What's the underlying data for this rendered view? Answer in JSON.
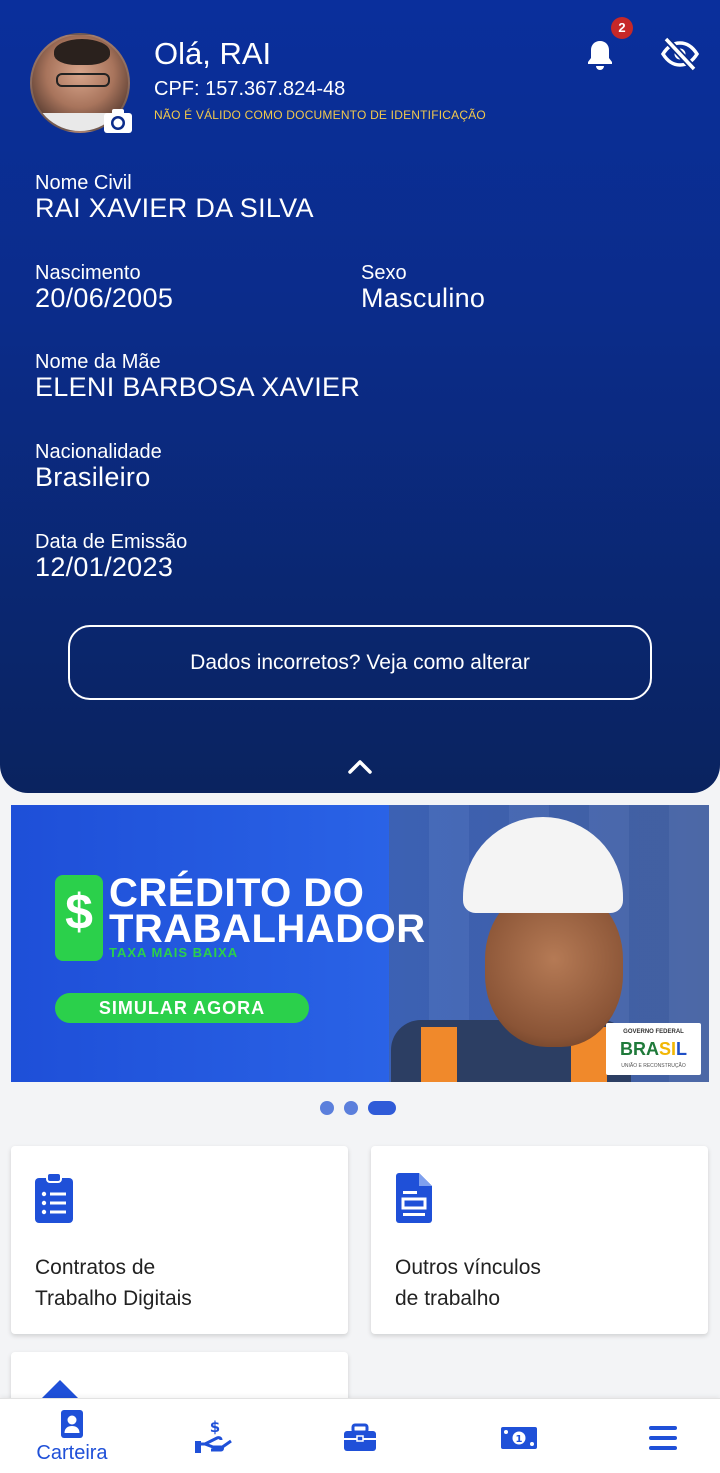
{
  "header": {
    "greeting": "Olá, RAI",
    "cpf": "CPF: 157.367.824-48",
    "disclaimer": "NÃO É VÁLIDO COMO DOCUMENTO DE IDENTIFICAÇÃO",
    "notification_count": "2"
  },
  "identity": {
    "nome_civil_label": "Nome Civil",
    "nome_civil": "RAI XAVIER DA SILVA",
    "nascimento_label": "Nascimento",
    "nascimento": "20/06/2005",
    "sexo_label": "Sexo",
    "sexo": "Masculino",
    "mae_label": "Nome da Mãe",
    "mae": "ELENI BARBOSA XAVIER",
    "nacionalidade_label": "Nacionalidade",
    "nacionalidade": "Brasileiro",
    "emissao_label": "Data de Emissão",
    "emissao": "12/01/2023",
    "alter_button": "Dados incorretos? Veja como alterar"
  },
  "banner": {
    "title_line1": "CRÉDITO DO",
    "title_line2": "TRABALHADOR",
    "subtitle": "TAXA MAIS BAIXA",
    "cta": "SIMULAR AGORA",
    "gov_top": "GOVERNO FEDERAL",
    "gov_word_1": "BRA",
    "gov_word_2": "SI",
    "gov_word_3": "L",
    "gov_foot": "UNIÃO E RECONSTRUÇÃO",
    "slides_total": 3,
    "slide_active": 3
  },
  "cards": [
    {
      "label": "Contratos de\nTrabalho Digitais",
      "icon": "clipboard-list-icon"
    },
    {
      "label": "Outros vínculos\nde trabalho",
      "icon": "document-icon"
    }
  ],
  "nav": {
    "carteira": "Carteira"
  },
  "colors": {
    "primary": "#1f50d8",
    "hero_top": "#0a2f9c",
    "hero_bottom": "#0a235f",
    "accent_green": "#2bd04b",
    "warning": "#f2c94c"
  }
}
